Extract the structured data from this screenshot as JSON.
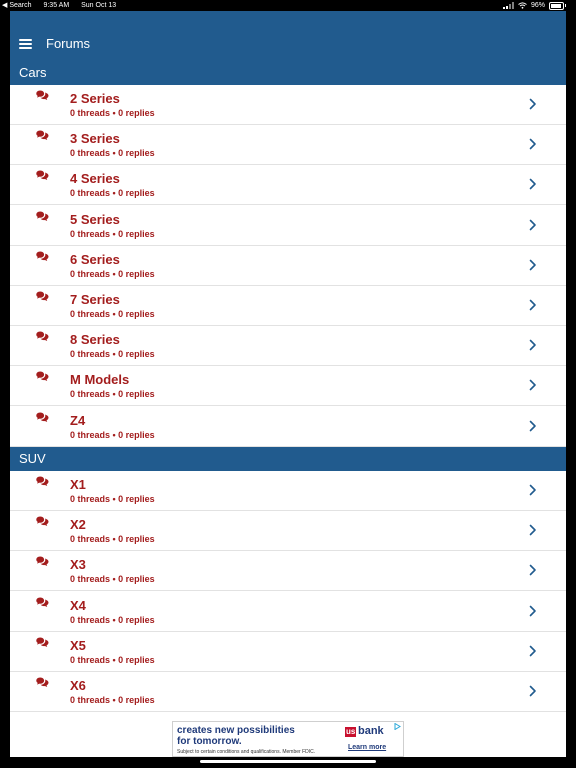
{
  "status_bar": {
    "back_app": "◀ Search",
    "time": "9:35 AM",
    "date": "Sun Oct 13",
    "battery": "96%"
  },
  "nav": {
    "title": "Forums"
  },
  "sections": [
    {
      "title": "Cars"
    },
    {
      "title": "SUV"
    }
  ],
  "forums": [
    {
      "name": "2 Series",
      "stats": "0 threads • 0 replies"
    },
    {
      "name": "3 Series",
      "stats": "0 threads • 0 replies"
    },
    {
      "name": "4 Series",
      "stats": "0 threads • 0 replies"
    },
    {
      "name": "5 Series",
      "stats": "0 threads • 0 replies"
    },
    {
      "name": "6 Series",
      "stats": "0 threads • 0 replies"
    },
    {
      "name": "7 Series",
      "stats": "0 threads • 0 replies"
    },
    {
      "name": "8 Series",
      "stats": "0 threads • 0 replies"
    },
    {
      "name": "M Models",
      "stats": "0 threads • 0 replies"
    },
    {
      "name": "Z4",
      "stats": "0 threads • 0 replies"
    },
    {
      "name": "X1",
      "stats": "0 threads • 0 replies"
    },
    {
      "name": "X2",
      "stats": "0 threads • 0 replies"
    },
    {
      "name": "X3",
      "stats": "0 threads • 0 replies"
    },
    {
      "name": "X4",
      "stats": "0 threads • 0 replies"
    },
    {
      "name": "X5",
      "stats": "0 threads • 0 replies"
    },
    {
      "name": "X6",
      "stats": "0 threads • 0 replies"
    }
  ],
  "ad": {
    "headline": "creates new possibilities\nfor tomorrow.",
    "fine_print": "Subject to certain conditions and qualifications. Member FDIC.",
    "logo_us": "us",
    "logo_bank": "bank",
    "cta": "Learn more"
  },
  "colors": {
    "nav_bg": "#215b8e",
    "forum_text": "#a31d1d",
    "chevron": "#215b8e"
  },
  "icons": {
    "menu": "hamburger-menu-icon",
    "forum": "chat-bubbles-icon",
    "row_action": "chevron-right-icon"
  }
}
